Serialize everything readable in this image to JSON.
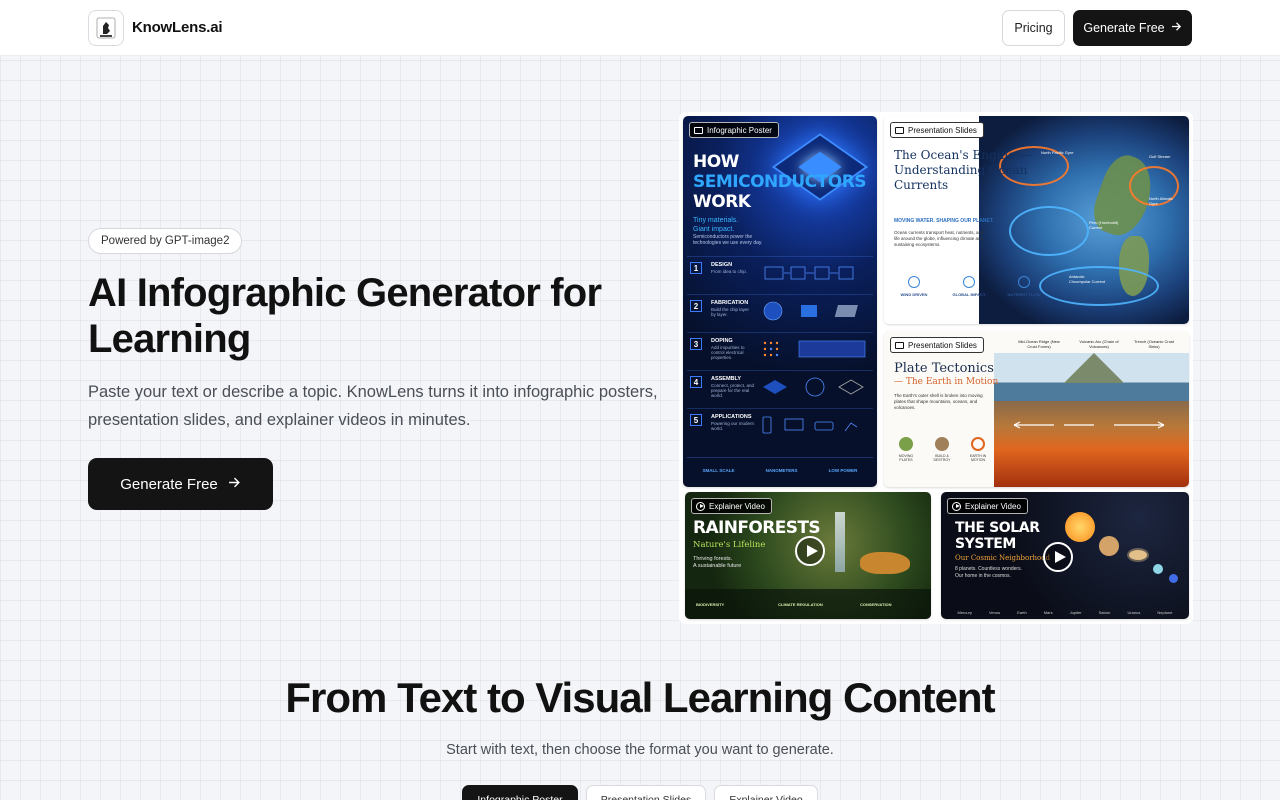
{
  "header": {
    "brand": "KnowLens.ai",
    "pricing_label": "Pricing",
    "cta_label": "Generate Free"
  },
  "hero": {
    "badge": "Powered by GPT-image2",
    "title": "AI Infographic Generator for Learning",
    "subtitle": "Paste your text or describe a topic. KnowLens turns it into infographic posters, presentation slides, and explainer videos in minutes.",
    "cta_label": "Generate Free"
  },
  "gallery": {
    "poster": {
      "tag": "Infographic Poster",
      "title_line1": "HOW",
      "title_line2": "SEMICONDUCTORS",
      "title_line3": "WORK",
      "tagline_1": "Tiny materials.",
      "tagline_2": "Giant impact.",
      "desc": "Semiconductors power the technologies we use every day.",
      "steps": [
        {
          "n": "1",
          "label": "DESIGN",
          "sub": "From idea to chip."
        },
        {
          "n": "2",
          "label": "FABRICATION",
          "sub": "Build the chip layer by layer."
        },
        {
          "n": "3",
          "label": "DOPING",
          "sub": "Add impurities to control electrical properties."
        },
        {
          "n": "4",
          "label": "ASSEMBLY",
          "sub": "Connect, protect, and prepare for the real world."
        },
        {
          "n": "5",
          "label": "APPLICATIONS",
          "sub": "Powering our modern world."
        }
      ],
      "footer": [
        "SMALL SCALE",
        "NANOMETERS",
        "LOW POWER"
      ]
    },
    "ocean": {
      "tag": "Presentation Slides",
      "title": "The Ocean's Engine — Understanding Ocean Currents",
      "kicker": "MOVING WATER. SHAPING OUR PLANET.",
      "paragraph": "Ocean currents transport heat, nutrients, and life around the globe, influencing climate and sustaining ecosystems.",
      "icons": [
        "WIND DRIVEN",
        "GLOBAL IMPACT",
        "NUTRIENT FLOW"
      ],
      "map_labels": [
        "North Pacific Gyre",
        "Gulf Stream",
        "North Atlantic Gyre",
        "Peru (Humboldt) Current",
        "Antarctic Circumpolar Current"
      ]
    },
    "tectonics": {
      "tag": "Presentation Slides",
      "title": "Plate Tectonics",
      "subtitle": "— The Earth in Motion",
      "paragraph": "The Earth's outer shell is broken into moving plates that shape mountains, oceans, and volcanoes.",
      "icons": [
        "MOVING PLATES",
        "BUILD & DESTROY",
        "EARTH IN MOTION"
      ],
      "labels": [
        "Mid-Ocean Ridge (New Crust Forms)",
        "Volcanic Arc (Chain of Volcanoes)",
        "Trench (Oceanic Crust Sinks)"
      ]
    },
    "rainforest": {
      "tag": "Explainer Video",
      "title": "RAINFORESTS",
      "subtitle": "Nature's Lifeline",
      "line1": "Thriving forests.",
      "line2": "A sustainable future",
      "footer": [
        "BIODIVERSITY",
        "CLIMATE REGULATION",
        "CONSERVATION"
      ]
    },
    "solar": {
      "tag": "Explainer Video",
      "title_line1": "THE SOLAR",
      "title_line2": "SYSTEM",
      "subtitle": "Our Cosmic Neighborhood",
      "line1": "8 planets. Countless wonders.",
      "line2": "Our home in the cosmos.",
      "planets": [
        "Mercury",
        "Venus",
        "Earth",
        "Mars",
        "Jupiter",
        "Saturn",
        "Uranus",
        "Neptune"
      ]
    }
  },
  "section2": {
    "title": "From Text to Visual Learning Content",
    "subtitle": "Start with text, then choose the format you want to generate.",
    "tabs": [
      "Infographic Poster",
      "Presentation Slides",
      "Explainer Video"
    ]
  },
  "colors": {
    "primary": "#141414",
    "background": "#f4f5f8",
    "accent_blue": "#2fa7ff"
  }
}
